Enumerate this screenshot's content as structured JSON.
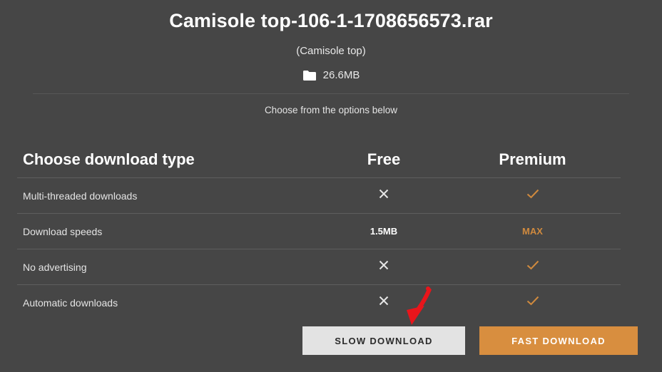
{
  "file": {
    "name": "Camisole top-106-1-1708656573.rar",
    "subtitle": "(Camisole top)",
    "size": "26.6MB",
    "folder_icon": "folder-icon"
  },
  "options_hint": "Choose from the options below",
  "table": {
    "header": {
      "feature": "Choose download type",
      "free": "Free",
      "premium": "Premium"
    },
    "rows": [
      {
        "feature": "Multi-threaded downloads",
        "free": "cross-icon",
        "premium": "check-icon"
      },
      {
        "feature": "Download speeds",
        "free": "1.5MB",
        "premium": "MAX"
      },
      {
        "feature": "No advertising",
        "free": "cross-icon",
        "premium": "check-icon"
      },
      {
        "feature": "Automatic downloads",
        "free": "cross-icon",
        "premium": "check-icon"
      }
    ]
  },
  "buttons": {
    "slow": "SLOW DOWNLOAD",
    "fast": "FAST DOWNLOAD"
  },
  "colors": {
    "background": "#464646",
    "accent": "#d88e3f",
    "check": "#d08a3e",
    "arrow": "#e8151b"
  }
}
